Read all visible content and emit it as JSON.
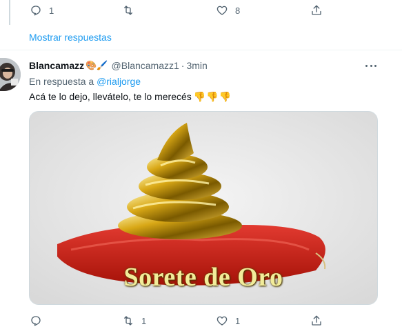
{
  "previous_tweet": {
    "reply_count": "1",
    "retweet_count": "",
    "like_count": "8",
    "show_replies_label": "Mostrar respuestas"
  },
  "tweet": {
    "display_name": "Blancamazz",
    "name_emojis": "🎨🖌️",
    "handle": "@Blancamazz1",
    "separator": "·",
    "time": "3min",
    "reply_prefix": "En respuesta a",
    "reply_mention": "@rialjorge",
    "text": "Acá te lo dejo, llevátelo, te lo merecés",
    "text_emojis": "👎👎👎",
    "image_caption": "Sorete de Oro",
    "reply_count": "",
    "retweet_count": "1",
    "like_count": "1"
  },
  "icons": {
    "reply": "reply-icon",
    "retweet": "retweet-icon",
    "like": "heart-icon",
    "share": "share-icon",
    "more": "more-icon"
  },
  "colors": {
    "accent": "#1d9bf0",
    "secondary_text": "#536471",
    "divider": "#eff3f4"
  }
}
